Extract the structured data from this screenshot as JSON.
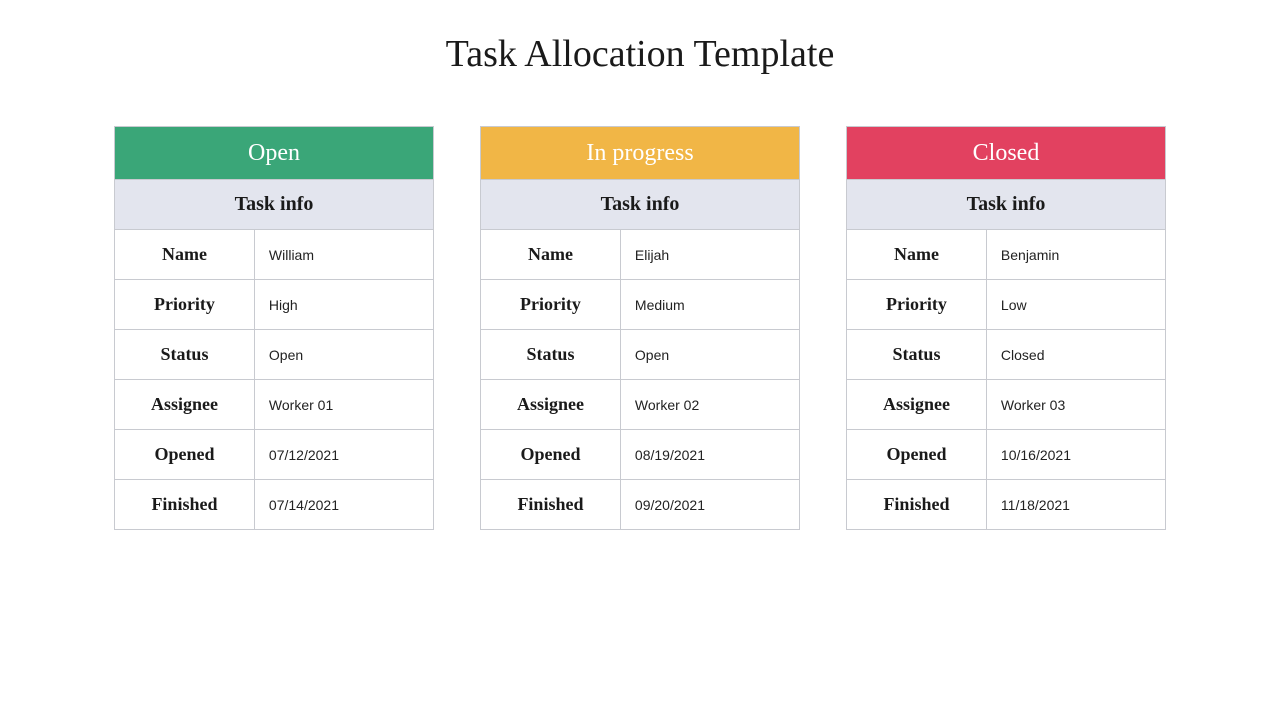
{
  "title": "Task Allocation Template",
  "subheader": "Task info",
  "field_labels": {
    "name": "Name",
    "priority": "Priority",
    "status": "Status",
    "assignee": "Assignee",
    "opened": "Opened",
    "finished": "Finished"
  },
  "columns": [
    {
      "status_title": "Open",
      "color": "#3aa678",
      "name": "William",
      "priority": "High",
      "status": "Open",
      "assignee": "Worker 01",
      "opened": "07/12/2021",
      "finished": "07/14/2021"
    },
    {
      "status_title": "In progress",
      "color": "#f1b646",
      "name": "Elijah",
      "priority": "Medium",
      "status": "Open",
      "assignee": "Worker 02",
      "opened": "08/19/2021",
      "finished": "09/20/2021"
    },
    {
      "status_title": "Closed",
      "color": "#e24160",
      "name": "Benjamin",
      "priority": "Low",
      "status": "Closed",
      "assignee": "Worker 03",
      "opened": "10/16/2021",
      "finished": "11/18/2021"
    }
  ]
}
